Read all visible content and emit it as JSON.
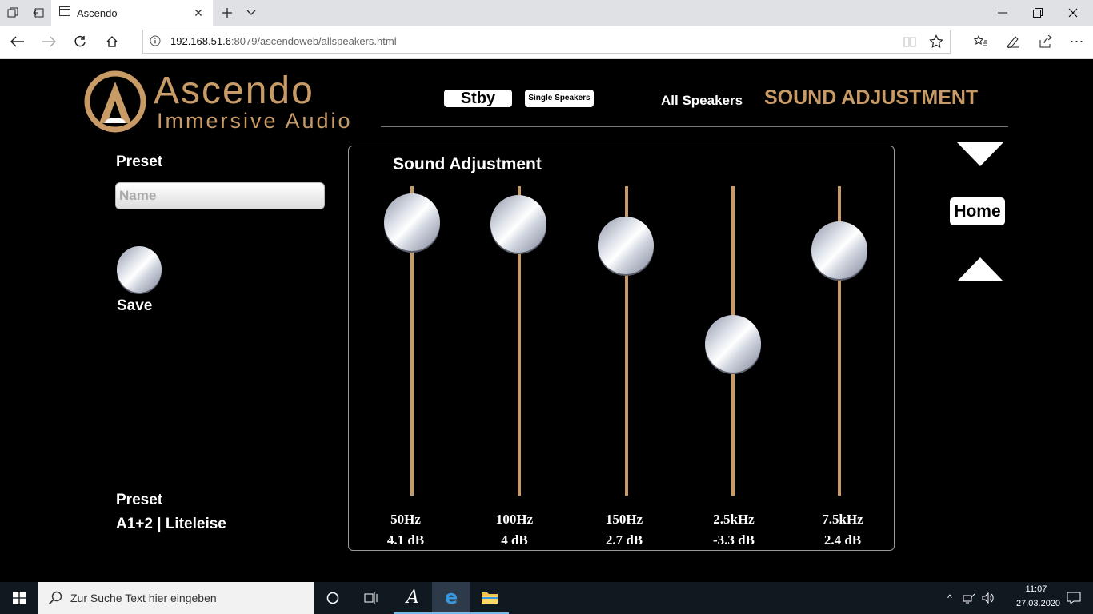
{
  "browser": {
    "tab_title": "Ascendo",
    "url_host": "192.168.51.6",
    "url_rest": ":8079/ascendoweb/allspeakers.html"
  },
  "header": {
    "brand_name": "Ascendo",
    "brand_sub": "Immersive Audio",
    "stby_label": "Stby",
    "single_speakers_label": "Single Speakers",
    "all_speakers_label": "All Speakers",
    "page_heading": "SOUND ADJUSTMENT"
  },
  "left_panel": {
    "preset_heading": "Preset",
    "name_placeholder": "Name",
    "save_label": "Save",
    "current_preset_heading": "Preset",
    "current_preset_value": "A1+2 | Liteleise"
  },
  "sound_panel": {
    "title": "Sound Adjustment",
    "bands": [
      {
        "freq": "50Hz",
        "gain": "4.1 dB",
        "value": 4.1
      },
      {
        "freq": "100Hz",
        "gain": "4 dB",
        "value": 4.0
      },
      {
        "freq": "150Hz",
        "gain": "2.7 dB",
        "value": 2.7
      },
      {
        "freq": "2.5kHz",
        "gain": "-3.3 dB",
        "value": -3.3
      },
      {
        "freq": "7.5kHz",
        "gain": "2.4 dB",
        "value": 2.4
      }
    ]
  },
  "right_controls": {
    "home_label": "Home"
  },
  "taskbar": {
    "search_placeholder": "Zur Suche Text hier eingeben",
    "time": "11:07",
    "date": "27.03.2020"
  },
  "colors": {
    "accent_gold": "#c89a66",
    "background": "#000000"
  }
}
